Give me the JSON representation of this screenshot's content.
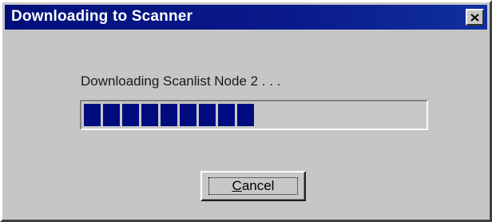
{
  "window": {
    "title": "Downloading to Scanner",
    "close_icon": "close-icon"
  },
  "status": {
    "message": "Downloading Scanlist Node 2 . . ."
  },
  "progress": {
    "filled_blocks": 9,
    "fraction": 0.49,
    "color": "#000b80"
  },
  "buttons": {
    "cancel": {
      "mnemonic": "C",
      "rest": "ancel"
    }
  },
  "colors": {
    "titlebar": "#00107a",
    "face": "#c8c8c8"
  }
}
